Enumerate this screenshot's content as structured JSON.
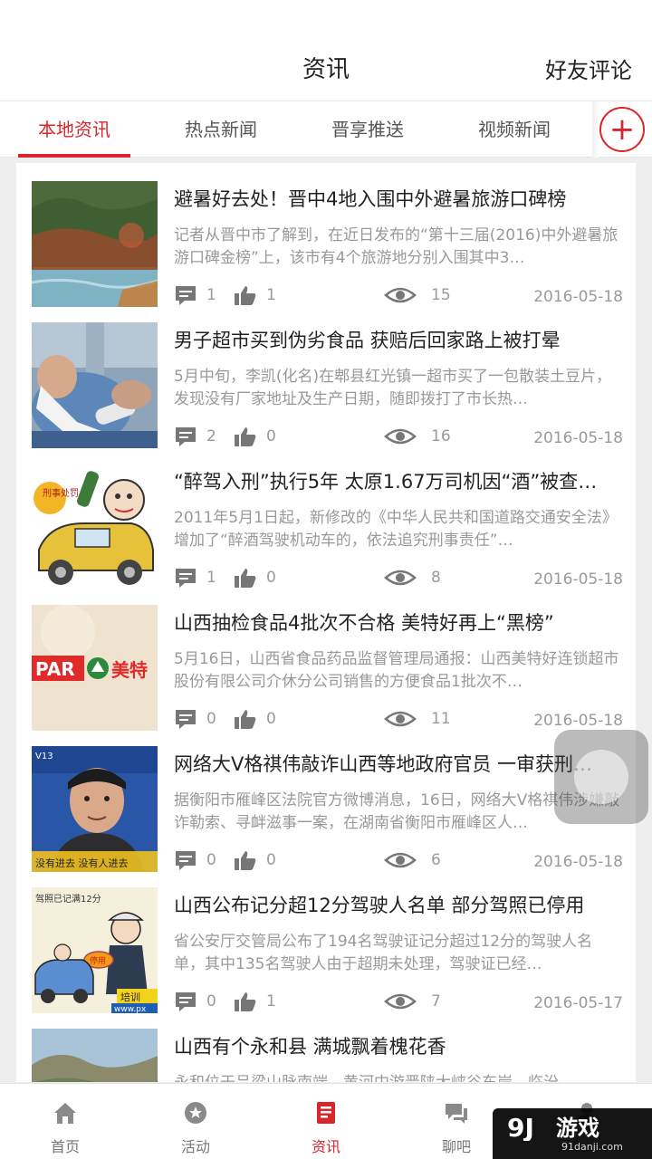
{
  "header": {
    "title": "资讯",
    "right_link": "好友评论"
  },
  "tabs": [
    {
      "label": "本地资讯",
      "active": true
    },
    {
      "label": "热点新闻",
      "active": false
    },
    {
      "label": "晋享推送",
      "active": false
    },
    {
      "label": "视频新闻",
      "active": false
    }
  ],
  "add_button": {
    "icon": "plus-icon",
    "symbol": "+"
  },
  "accent_color": "#d7262c",
  "news": [
    {
      "title": "避暑好去处！晋中4地入围中外避暑旅游口碑榜",
      "desc": "记者从晋中市了解到，在近日发布的“第十三届(2016)中外避暑旅游口碑金榜”上，该市有4个旅游地分别入围其中3…",
      "comments": "1",
      "likes": "1",
      "views": "15",
      "date": "2016-05-18"
    },
    {
      "title": "男子超市买到伪劣食品 获赔后回家路上被打晕",
      "desc": "5月中旬，李凯(化名)在郫县红光镇一超市买了一包散装土豆片，发现没有厂家地址及生产日期，随即拨打了市长热…",
      "comments": "2",
      "likes": "0",
      "views": "16",
      "date": "2016-05-18"
    },
    {
      "title": "“醉驾入刑”执行5年 太原1.67万司机因“酒”被查…",
      "desc": "2011年5月1日起，新修改的《中华人民共和国道路交通安全法》增加了“醉酒驾驶机动车的，依法追究刑事责任”…",
      "comments": "1",
      "likes": "0",
      "views": "8",
      "date": "2016-05-18"
    },
    {
      "title": "山西抽检食品4批次不合格 美特好再上“黑榜”",
      "desc": "5月16日，山西省食品药品监督管理局通报：山西美特好连锁超市股份有限公司介休分公司销售的方便食品1批次不…",
      "comments": "0",
      "likes": "0",
      "views": "11",
      "date": "2016-05-18"
    },
    {
      "title": "网络大V格祺伟敲诈山西等地政府官员 一审获刑…",
      "desc": "据衡阳市雁峰区法院官方微博消息，16日，网络大V格祺伟涉嫌敲诈勒索、寻衅滋事一案，在湖南省衡阳市雁峰区人…",
      "comments": "0",
      "likes": "0",
      "views": "6",
      "date": "2016-05-18"
    },
    {
      "title": "山西公布记分超12分驾驶人名单 部分驾照已停用",
      "desc": "省公安厅交管局公布了194名驾驶证记分超过12分的驾驶人名单，其中135名驾驶人由于超期未处理，驾驶证已经…",
      "comments": "0",
      "likes": "1",
      "views": "7",
      "date": "2016-05-17"
    },
    {
      "title": "山西有个永和县 满城飘着槐花香",
      "desc": "永和位于吕梁山脉南端，黄河中游晋陕大峡谷东岸，临汾…",
      "comments": "",
      "likes": "",
      "views": "",
      "date": ""
    }
  ],
  "thumb_text": {
    "t3_sign": "刑事处罚",
    "t4_brand_left": "PAR",
    "t4_brand_right": "美特",
    "t5_overlay": "没有进去 没有人进去",
    "t5_tag": "V13",
    "t6_text": "驾照已记满12分",
    "t6_sign": "停用",
    "t6_banner": "培训",
    "t6_url": "www.px"
  },
  "bottom_nav": [
    {
      "label": "首页",
      "icon": "home-icon",
      "active": false
    },
    {
      "label": "活动",
      "icon": "star-badge-icon",
      "active": false
    },
    {
      "label": "资讯",
      "icon": "news-icon",
      "active": true
    },
    {
      "label": "聊吧",
      "icon": "chat-icon",
      "active": false
    },
    {
      "label": "",
      "icon": "user-icon",
      "active": false
    }
  ],
  "watermark": {
    "main": "游戏",
    "logo": "9J",
    "url": "91danji.com"
  }
}
